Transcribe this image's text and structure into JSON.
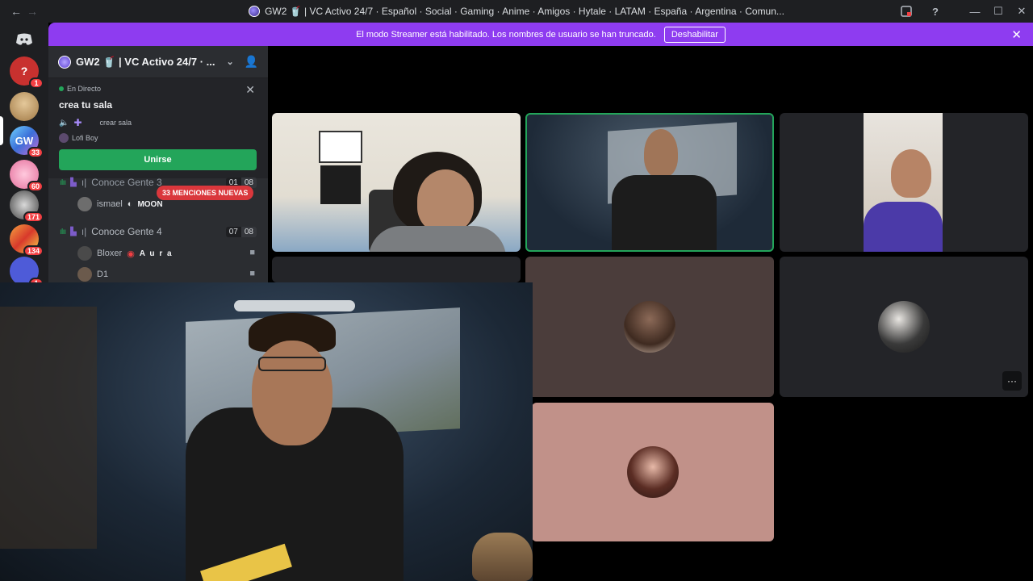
{
  "titlebar": {
    "back": "←",
    "forward": "→",
    "title": "GW2 🥤 | VC Activo 24/7 · Español · Social · Gaming · Anime · Amigos · Hytale · LATAM · España · Argentina · Comun...",
    "inbox_icon": "inbox-icon",
    "help": "?",
    "minimize": "—",
    "maximize": "☐",
    "close": "✕"
  },
  "banner": {
    "text": "El modo Streamer está habilitado. Los nombres de usuario se han truncado.",
    "button": "Deshabilitar",
    "close": "✕"
  },
  "rail": {
    "items": [
      {
        "name": "discord-home",
        "label": "",
        "badge": ""
      },
      {
        "name": "server-q",
        "label": "?",
        "badge": "1"
      },
      {
        "name": "server-cat",
        "label": "",
        "badge": ""
      },
      {
        "name": "server-gw",
        "label": "GW",
        "badge": "33"
      },
      {
        "name": "server-pink",
        "label": "",
        "badge": "60"
      },
      {
        "name": "server-anime",
        "label": "",
        "badge": "171"
      },
      {
        "name": "server-colorful",
        "label": "",
        "badge": "134"
      },
      {
        "name": "server-blue",
        "label": "",
        "badge": "1"
      }
    ]
  },
  "sidebar": {
    "server_name": "GW2 🥤 | VC Activo 24/7 · ...",
    "live": {
      "status": "En Directo",
      "title": "crea tu sala",
      "action_label": "crear sala",
      "user": "Lofi Boy",
      "join": "Unirse"
    },
    "channels": [
      {
        "name": "Conoce Gente 3",
        "prefix": "ı|",
        "count_a": "01",
        "count_b": "08"
      },
      {
        "name": "Conoce Gente 4",
        "prefix": "ı|",
        "count_a": "07",
        "count_b": "08"
      }
    ],
    "members": [
      {
        "name": "ismael",
        "tag": "MOON"
      },
      {
        "name": "Bloxer",
        "tag": "A u r a"
      },
      {
        "name": "D1",
        "tag": ""
      }
    ],
    "mentions": "33 MENCIONES NUEVAS"
  },
  "tiles": {
    "more": "···"
  }
}
